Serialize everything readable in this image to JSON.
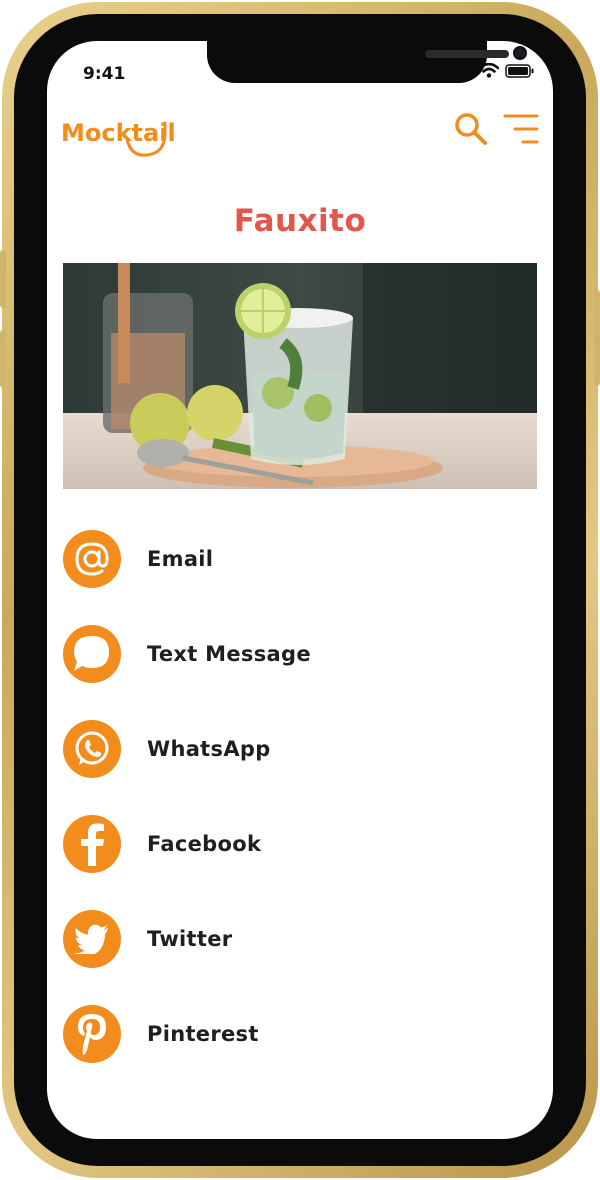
{
  "device": {
    "status_time": "9:41"
  },
  "header": {
    "brand": "Mocktail"
  },
  "colors": {
    "brand_orange": "#f28c1c",
    "title_red": "#e2574c",
    "text": "#1f1f1f"
  },
  "page": {
    "title": "Fauxito"
  },
  "hero": {
    "icon": "mocktail-photo"
  },
  "share_options": [
    {
      "label": "Email",
      "icon": "at-sign-icon"
    },
    {
      "label": "Text Message",
      "icon": "message-bubble-icon"
    },
    {
      "label": "WhatsApp",
      "icon": "whatsapp-icon"
    },
    {
      "label": "Facebook",
      "icon": "facebook-icon"
    },
    {
      "label": "Twitter",
      "icon": "twitter-icon"
    },
    {
      "label": "Pinterest",
      "icon": "pinterest-icon"
    }
  ]
}
